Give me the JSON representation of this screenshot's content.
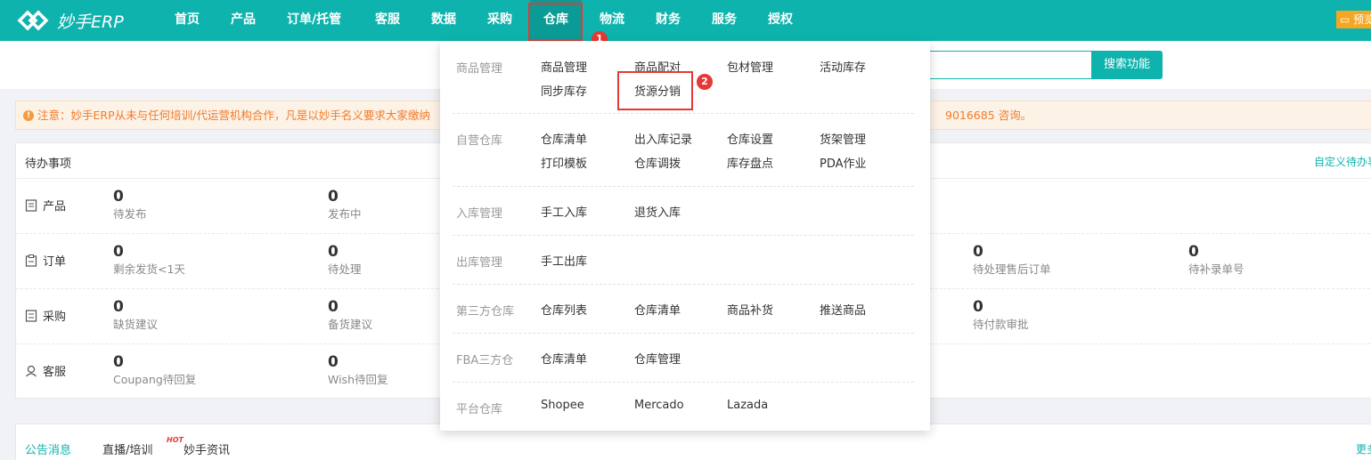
{
  "app": {
    "logo_text": "妙手ERP",
    "preview_label": "预览"
  },
  "nav": {
    "items": [
      "首页",
      "产品",
      "订单/托管",
      "客服",
      "数据",
      "采购",
      "仓库",
      "物流",
      "财务",
      "服务",
      "授权"
    ],
    "active": "仓库",
    "step_badges": [
      "1",
      "2"
    ]
  },
  "search": {
    "button_label": "搜索功能",
    "placeholder": ""
  },
  "notice": {
    "text_left": "注意：妙手ERP从未与任何培训/代运营机构合作，凡是以妙手名义要求大家缴纳",
    "text_right": "9016685 咨询。"
  },
  "todo": {
    "title": "待办事项",
    "custom_link": "自定义待办事",
    "rows": [
      {
        "label": "产品",
        "icon": "product-icon",
        "cells": [
          {
            "num": "0",
            "label": "待发布"
          },
          {
            "num": "0",
            "label": "发布中"
          }
        ]
      },
      {
        "label": "订单",
        "icon": "order-icon",
        "cells": [
          {
            "num": "0",
            "label": "剩余发货<1天"
          },
          {
            "num": "0",
            "label": "待处理"
          },
          {
            "num": "0",
            "label": "待处理售后订单"
          },
          {
            "num": "0",
            "label": "待补录单号"
          }
        ]
      },
      {
        "label": "采购",
        "icon": "purchase-icon",
        "cells": [
          {
            "num": "0",
            "label": "缺货建议"
          },
          {
            "num": "0",
            "label": "备货建议"
          },
          {
            "num": "0",
            "label": "待付款审批"
          }
        ]
      },
      {
        "label": "客服",
        "icon": "service-icon",
        "cells": [
          {
            "num": "0",
            "label": "Coupang待回复"
          },
          {
            "num": "0",
            "label": "Wish待回复"
          }
        ]
      }
    ]
  },
  "bottom": {
    "tabs": [
      "公告消息",
      "直播/培训",
      "妙手资讯"
    ],
    "hot_badge": "HOT",
    "more_label": "更多"
  },
  "dropdown": {
    "groups": [
      {
        "category": "商品管理",
        "items": [
          "商品管理",
          "商品配对",
          "包材管理",
          "活动库存",
          "同步库存",
          "货源分销"
        ]
      },
      {
        "category": "自营仓库",
        "items": [
          "仓库清单",
          "出入库记录",
          "仓库设置",
          "货架管理",
          "打印模板",
          "仓库调拨",
          "库存盘点",
          "PDA作业"
        ]
      },
      {
        "category": "入库管理",
        "items": [
          "手工入库",
          "退货入库"
        ]
      },
      {
        "category": "出库管理",
        "items": [
          "手工出库"
        ]
      },
      {
        "category": "第三方仓库",
        "items": [
          "仓库列表",
          "仓库清单",
          "商品补货",
          "推送商品"
        ]
      },
      {
        "category": "FBA三方仓",
        "items": [
          "仓库清单",
          "仓库管理"
        ]
      },
      {
        "category": "平台仓库",
        "items": [
          "Shopee",
          "Mercado",
          "Lazada"
        ]
      }
    ]
  },
  "colors": {
    "brand": "#0fb3ad",
    "highlight_red": "#e53935",
    "notice_orange": "#f07c2d"
  }
}
